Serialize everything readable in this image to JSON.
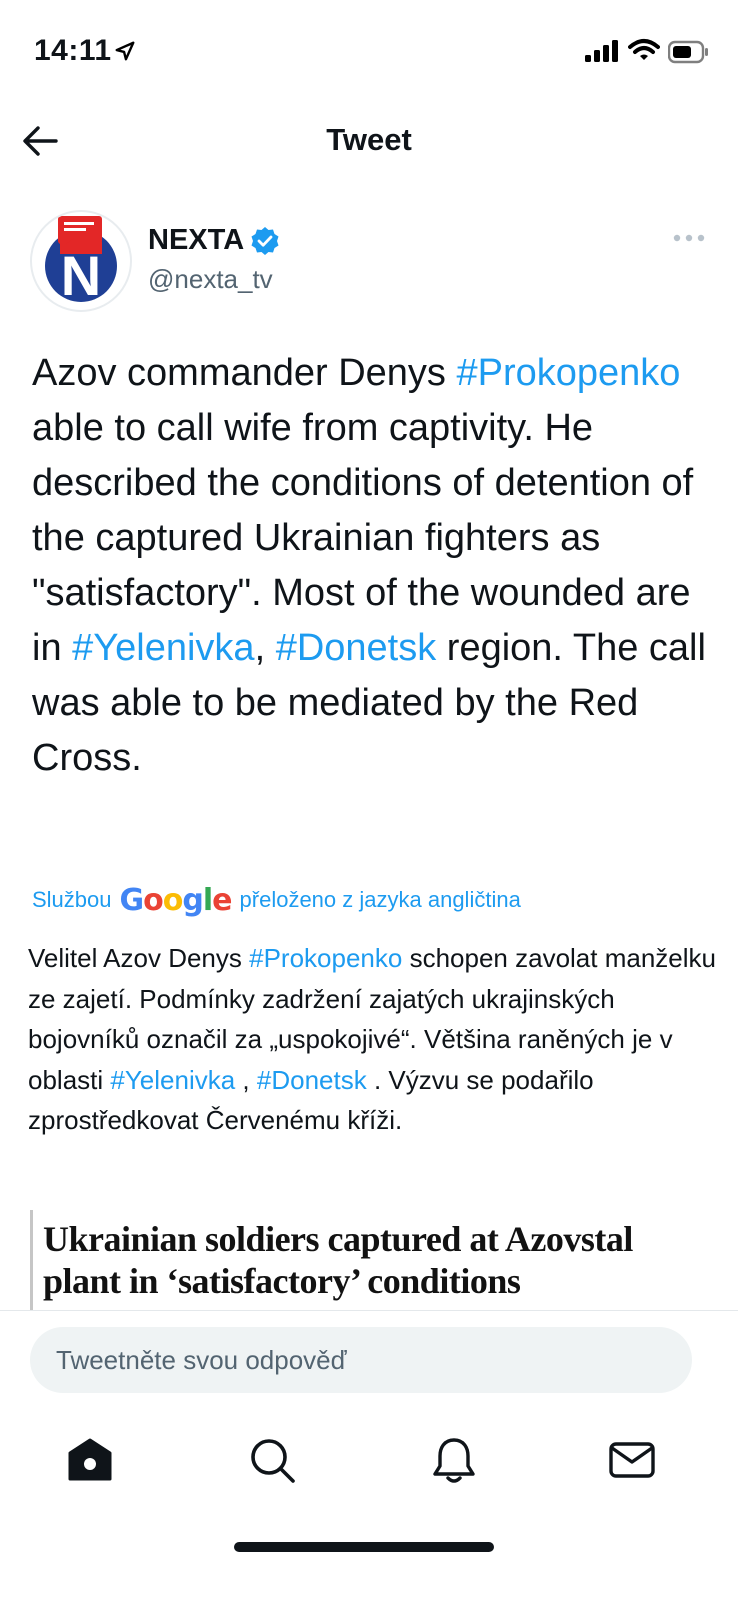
{
  "status_bar": {
    "time": "14:11",
    "icons": [
      "location-arrow-icon",
      "signal-icon",
      "wifi-icon",
      "battery-icon"
    ]
  },
  "header": {
    "title": "Tweet",
    "back_icon": "arrow-left-icon"
  },
  "author": {
    "name": "NEXTA",
    "handle": "@nexta_tv",
    "verified": true,
    "avatar_letter": "N",
    "more_icon": "ellipsis-icon"
  },
  "tweet": {
    "segments": [
      {
        "text": "Azov commander Denys ",
        "type": "text"
      },
      {
        "text": "#Prokopenko",
        "type": "hashtag"
      },
      {
        "text": " able to call wife from captivity. He described the conditions of detention of the captured Ukrainian fighters as \"satisfactory\". Most of the wounded are in ",
        "type": "text"
      },
      {
        "text": "#Yelenivka",
        "type": "hashtag"
      },
      {
        "text": ", ",
        "type": "text"
      },
      {
        "text": "#Donetsk",
        "type": "hashtag"
      },
      {
        "text": " region. The call was able to be mediated by the Red Cross.",
        "type": "text"
      }
    ]
  },
  "translation": {
    "prefix": "Službou",
    "provider": "Google",
    "suffix": "přeloženo z jazyka angličtina",
    "segments": [
      {
        "text": "Velitel Azov Denys ",
        "type": "text"
      },
      {
        "text": "#Prokopenko",
        "type": "hashtag"
      },
      {
        "text": " schopen zavolat manželku ze zajetí. Podmínky zadržení zajatých ukrajinských bojovníků označil za „uspokojivé“. Většina raněných je v oblasti ",
        "type": "text"
      },
      {
        "text": "#Yelenivka",
        "type": "hashtag"
      },
      {
        "text": " , ",
        "type": "text"
      },
      {
        "text": "#Donetsk",
        "type": "hashtag"
      },
      {
        "text": " . Výzvu se podařilo zprostředkovat Červenému kříži.",
        "type": "text"
      }
    ]
  },
  "card": {
    "headline": "Ukrainian soldiers captured at Azovstal plant in ‘satisfactory’ conditions"
  },
  "reply": {
    "placeholder": "Tweetněte svou odpověď"
  },
  "tab_bar": {
    "items": [
      "home-icon",
      "search-icon",
      "bell-icon",
      "mail-icon"
    ]
  },
  "colors": {
    "accent": "#1d9bf0",
    "text": "#0f1419",
    "secondary": "#536471",
    "reply_bg": "#eff3f4",
    "avatar_red": "#e32727",
    "avatar_blue": "#1f3f95"
  }
}
